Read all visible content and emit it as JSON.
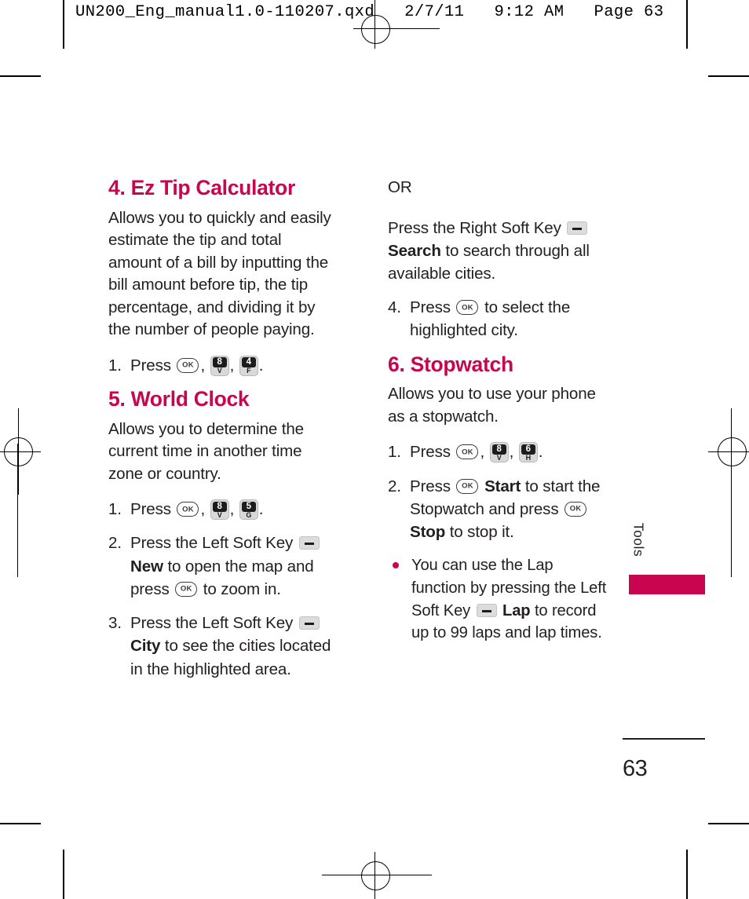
{
  "print_header": {
    "text": "UN200_Eng_manual1.0-110207.qxd   2/7/11   9:12 AM   Page 63"
  },
  "icons": {
    "ok_key_label": "OK",
    "soft_key": "soft-key-dash"
  },
  "left_column": {
    "sections": [
      {
        "heading": "4. Ez Tip Calculator",
        "intro": "Allows you to quickly and easily estimate the tip and total amount of a bill by inputting the bill amount before tip, the tip percentage, and dividing it by the number of people paying.",
        "step1_num": "1.",
        "step1_press": "Press",
        "step1_keys": [
          {
            "num": "8",
            "letter": "V"
          },
          {
            "num": "4",
            "letter": "F"
          }
        ],
        "step1_tail": "."
      },
      {
        "heading": "5. World Clock",
        "intro": "Allows you to determine the current time in another time zone or country.",
        "step1_num": "1.",
        "step1_press": "Press",
        "step1_keys": [
          {
            "num": "8",
            "letter": "V"
          },
          {
            "num": "5",
            "letter": "G"
          }
        ],
        "step1_tail": ".",
        "step2_num": "2.",
        "step2_a": "Press the Left Soft Key",
        "step2_b": "New",
        "step2_c": "to open the map and press",
        "step2_d": "to zoom in.",
        "step3_num": "3.",
        "step3_a": "Press the Left Soft Key",
        "step3_b": "City",
        "step3_c": "to see the cities located in the highlighted area."
      }
    ]
  },
  "right_column": {
    "or_label": "OR",
    "or_a": "Press the Right Soft Key",
    "or_b": "Search",
    "or_c": "to search through all available cities.",
    "step4_num": "4.",
    "step4_a": "Press",
    "step4_b": "to select the highlighted city.",
    "stopwatch": {
      "heading": "6. Stopwatch",
      "intro": "Allows you to use your phone as a stopwatch.",
      "step1_num": "1.",
      "step1_press": "Press",
      "step1_keys": [
        {
          "num": "8",
          "letter": "V"
        },
        {
          "num": "6",
          "letter": "H"
        }
      ],
      "step1_tail": ".",
      "step2_num": "2.",
      "step2_a": "Press",
      "step2_b": "Start",
      "step2_c": "to start the Stopwatch and press",
      "step2_d": "Stop",
      "step2_e": "to stop it.",
      "bullet_a": "You can use the Lap function by pressing the Left Soft Key",
      "bullet_b": "Lap",
      "bullet_c": "to record up to 99 laps and lap times."
    }
  },
  "side_tab": {
    "label": "Tools",
    "accent_color": "#c8064f"
  },
  "folio": {
    "page_number": "63"
  }
}
